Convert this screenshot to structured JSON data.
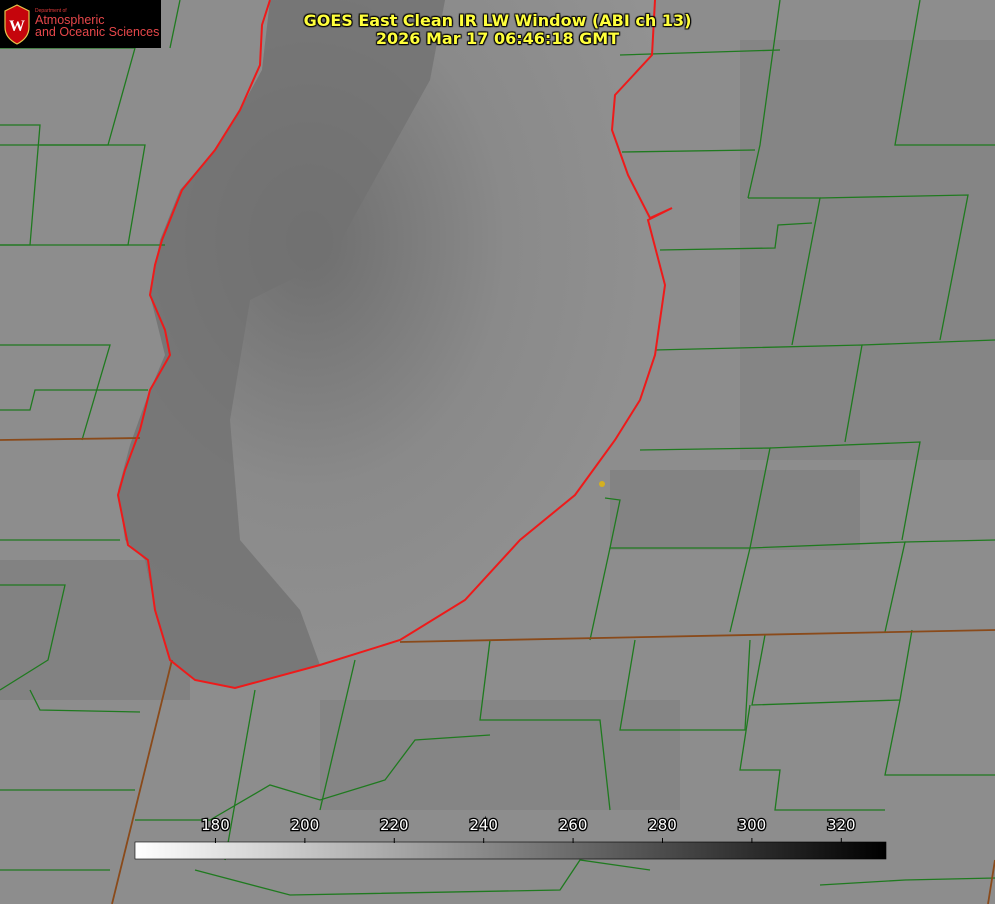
{
  "logo": {
    "department": "Department of",
    "unit_line1": "Atmospheric",
    "unit_line2": "and Oceanic Sciences",
    "emblem": "uw-crest-icon"
  },
  "title": {
    "line1": "GOES East Clean IR LW Window (ABI ch 13)",
    "line2": "2026 Mar 17 06:46:18 GMT"
  },
  "colorbar": {
    "ticks": [
      "180",
      "200",
      "220",
      "240",
      "260",
      "280",
      "300",
      "320"
    ],
    "tick_values": [
      180,
      200,
      220,
      240,
      260,
      280,
      300,
      320
    ],
    "range": [
      162,
      330
    ],
    "gradient": [
      "#ffffff",
      "#000000"
    ]
  },
  "colors": {
    "lake_shoreline": "#ee1a1a",
    "county_lines": "#1f7a1f",
    "state_lines": "#8a4a1a",
    "title_text": "#ffff3c",
    "marker": "#d4b020"
  }
}
